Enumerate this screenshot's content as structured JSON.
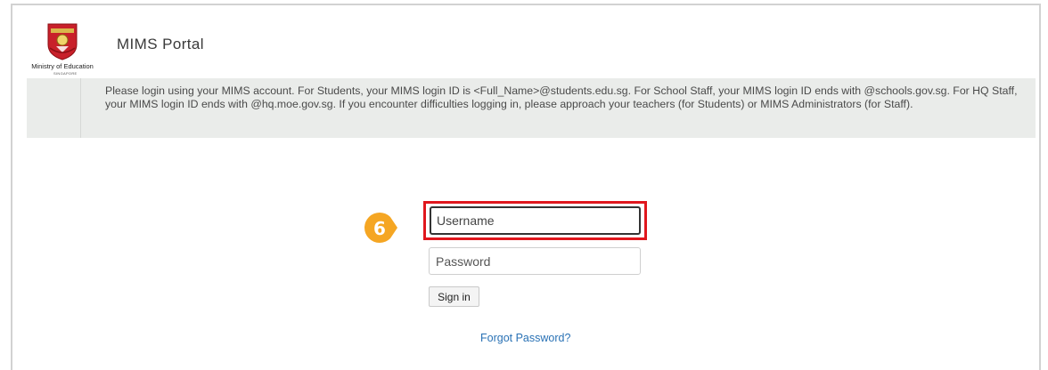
{
  "header": {
    "logo_ministry": "Ministry of Education",
    "logo_country": "SINGAPORE",
    "title": "MIMS Portal"
  },
  "notice": {
    "text": "Please login using your MIMS account. For Students, your MIMS login ID is <Full_Name>@students.edu.sg. For School Staff, your MIMS login ID ends with @schools.gov.sg. For HQ Staff, your MIMS login ID ends with @hq.moe.gov.sg. If you encounter difficulties logging in, please approach your teachers (for Students) or MIMS Administrators (for Staff)."
  },
  "login": {
    "username_placeholder": "Username",
    "password_placeholder": "Password",
    "signin_label": "Sign in",
    "forgot_label": "Forgot Password?"
  },
  "annotation": {
    "step_number": "6",
    "badge_color": "#f5a623",
    "highlight_color": "#e0171d"
  },
  "icons": {
    "crest": "moe-crest-icon"
  }
}
